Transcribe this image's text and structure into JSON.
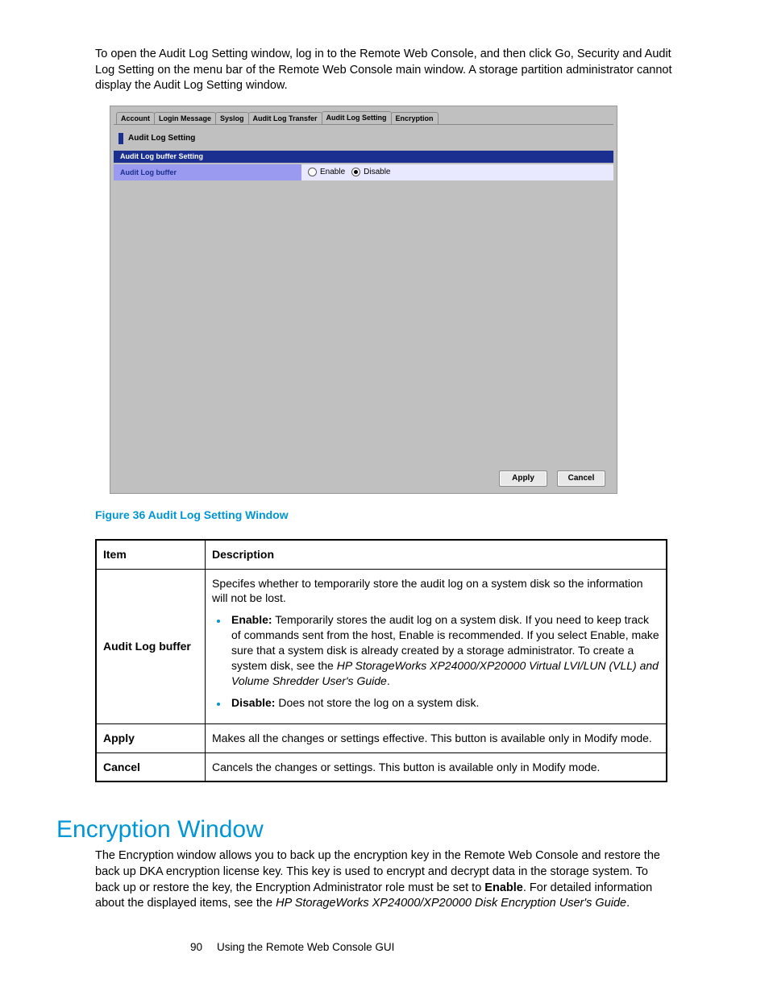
{
  "intro_text": "To open the Audit Log Setting window, log in to the Remote Web Console, and then click Go, Security and Audit Log Setting on the menu bar of the Remote Web Console main window. A storage partition administrator cannot display the Audit Log Setting window.",
  "screenshot": {
    "tabs": [
      "Account",
      "Login Message",
      "Syslog",
      "Audit Log Transfer",
      "Audit Log Setting",
      "Encryption"
    ],
    "panel_title": "Audit Log Setting",
    "section_header": "Audit Log buffer Setting",
    "row_label": "Audit Log buffer",
    "enable_label": "Enable",
    "disable_label": "Disable",
    "apply_btn": "Apply",
    "cancel_btn": "Cancel"
  },
  "figure_caption": "Figure 36 Audit Log Setting Window",
  "table": {
    "head_item": "Item",
    "head_desc": "Description",
    "r1_item": "Audit Log buffer",
    "r1_lead": "Specifes whether to temporarily store the audit log on a system disk so the information will not be lost.",
    "r1_b1_strong": "Enable:",
    "r1_b1_text_a": " Temporarily stores the audit log on a system disk. If you need to keep track of commands sent from the host, Enable is recommended. If you select Enable, make sure that a system disk is already created by a storage administrator. To create a system disk, see the ",
    "r1_b1_em": "HP StorageWorks XP24000/XP20000 Virtual LVI/LUN (VLL) and Volume Shredder User's Guide",
    "r1_b1_text_b": ".",
    "r1_b2_strong": "Disable:",
    "r1_b2_text": " Does not store the log on a system disk.",
    "r2_item": "Apply",
    "r2_desc": "Makes all the changes or settings effective. This button is available only in Modify mode.",
    "r3_item": "Cancel",
    "r3_desc": "Cancels the changes or settings. This button is available only in Modify mode."
  },
  "h2": "Encryption Window",
  "p2_a": "The Encryption window allows you to back up the encryption key in the Remote Web Console and restore the back up DKA encryption license key. This key is used to encrypt and decrypt data in the storage system. To back up or restore the key, the Encryption Administrator role must be set to ",
  "p2_strong": "Enable",
  "p2_b": ". For detailed information about the displayed items, see the ",
  "p2_em": "HP StorageWorks XP24000/XP20000 Disk Encryption User's Guide",
  "p2_c": ".",
  "footer": {
    "pagenum": "90",
    "chapter": "Using the Remote Web Console GUI"
  }
}
